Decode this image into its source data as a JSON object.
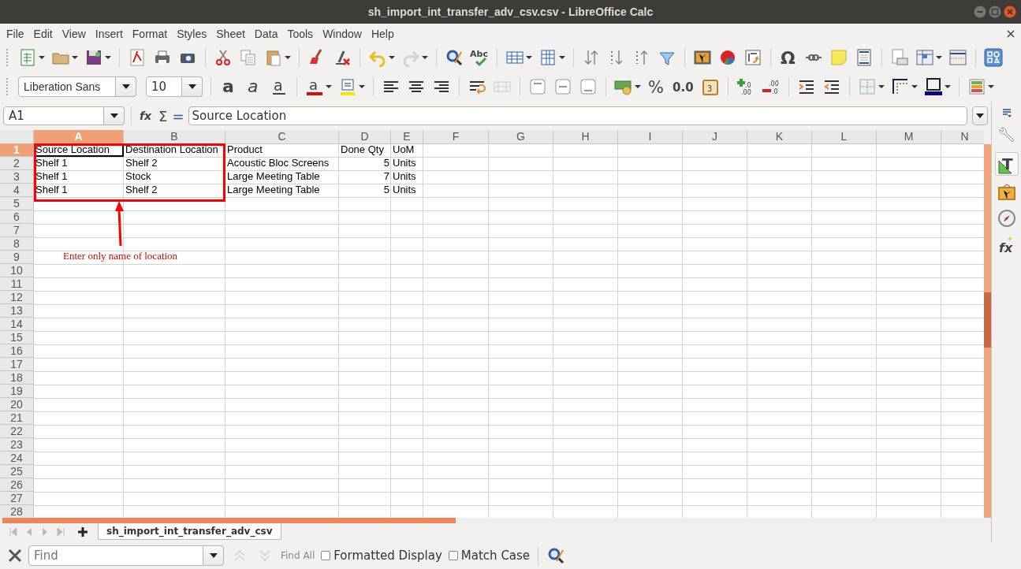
{
  "window": {
    "title": "sh_import_int_transfer_adv_csv.csv - LibreOffice Calc"
  },
  "menu": [
    "File",
    "Edit",
    "View",
    "Insert",
    "Format",
    "Styles",
    "Sheet",
    "Data",
    "Tools",
    "Window",
    "Help"
  ],
  "standard_toolbar": {
    "spelling_label": "Abc",
    "special_character_label": "Ω",
    "redo_disabled": true
  },
  "formatting_toolbar": {
    "font_name": "Liberation Sans",
    "font_size": "10",
    "bold_label": "a",
    "italic_label": "a",
    "underline_label": "a",
    "font_color_label": "a",
    "merge_disabled": true,
    "percent_label": "%",
    "decimal_label": "0.0",
    "date_label": "3",
    "add_decimal_label": [
      ".0",
      ".00"
    ],
    "delete_decimal_label": [
      ".00",
      ".0"
    ]
  },
  "formula_bar": {
    "name_box": "A1",
    "function_wizard_label": "fx",
    "sum_label": "Σ",
    "formula_label": "=",
    "content": "Source Location"
  },
  "sidebar": {
    "properties_label": "T",
    "functions_label": "fx"
  },
  "columns": [
    {
      "label": "A",
      "selected": true
    },
    {
      "label": "B",
      "selected": false
    },
    {
      "label": "C",
      "selected": false
    },
    {
      "label": "D",
      "selected": false
    },
    {
      "label": "E",
      "selected": false
    },
    {
      "label": "F",
      "selected": false
    },
    {
      "label": "G",
      "selected": false
    },
    {
      "label": "H",
      "selected": false
    },
    {
      "label": "I",
      "selected": false
    },
    {
      "label": "J",
      "selected": false
    },
    {
      "label": "K",
      "selected": false
    },
    {
      "label": "L",
      "selected": false
    },
    {
      "label": "M",
      "selected": false
    },
    {
      "label": "N",
      "selected": false
    }
  ],
  "rows": [
    {
      "label": "1",
      "selected": true,
      "cells": [
        {
          "text": "Source Location",
          "kind": "text"
        },
        {
          "text": "Destination Location",
          "kind": "text"
        },
        {
          "text": "Product",
          "kind": "text"
        },
        {
          "text": "Done Qty",
          "kind": "text"
        },
        {
          "text": "UoM",
          "kind": "text"
        }
      ]
    },
    {
      "label": "2",
      "selected": false,
      "cells": [
        {
          "text": "Shelf 1",
          "kind": "text"
        },
        {
          "text": "Shelf 2",
          "kind": "text"
        },
        {
          "text": "Acoustic Bloc Screens",
          "kind": "text"
        },
        {
          "text": "5",
          "kind": "number"
        },
        {
          "text": "Units",
          "kind": "text"
        }
      ]
    },
    {
      "label": "3",
      "selected": false,
      "cells": [
        {
          "text": "Shelf 1",
          "kind": "text"
        },
        {
          "text": "Stock",
          "kind": "text"
        },
        {
          "text": "Large Meeting Table",
          "kind": "text"
        },
        {
          "text": "7",
          "kind": "number"
        },
        {
          "text": "Units",
          "kind": "text"
        }
      ]
    },
    {
      "label": "4",
      "selected": false,
      "cells": [
        {
          "text": "Shelf 1",
          "kind": "text"
        },
        {
          "text": "Shelf 2",
          "kind": "text"
        },
        {
          "text": "Large Meeting Table",
          "kind": "text"
        },
        {
          "text": "5",
          "kind": "number"
        },
        {
          "text": "Units",
          "kind": "text"
        }
      ]
    },
    {
      "label": "5",
      "selected": false
    },
    {
      "label": "6",
      "selected": false
    },
    {
      "label": "7",
      "selected": false
    },
    {
      "label": "8",
      "selected": false
    },
    {
      "label": "9",
      "selected": false
    },
    {
      "label": "10",
      "selected": false
    },
    {
      "label": "11",
      "selected": false
    },
    {
      "label": "12",
      "selected": false
    },
    {
      "label": "13",
      "selected": false
    },
    {
      "label": "14",
      "selected": false
    },
    {
      "label": "15",
      "selected": false
    },
    {
      "label": "16",
      "selected": false
    },
    {
      "label": "17",
      "selected": false
    },
    {
      "label": "18",
      "selected": false
    },
    {
      "label": "19",
      "selected": false
    },
    {
      "label": "20",
      "selected": false
    },
    {
      "label": "21",
      "selected": false
    },
    {
      "label": "22",
      "selected": false
    },
    {
      "label": "23",
      "selected": false
    },
    {
      "label": "24",
      "selected": false
    },
    {
      "label": "25",
      "selected": false
    },
    {
      "label": "26",
      "selected": false
    },
    {
      "label": "27",
      "selected": false
    },
    {
      "label": "28",
      "selected": false
    }
  ],
  "annotation": {
    "note": "Enter only name of location"
  },
  "sheet_tabs": [
    {
      "label": "sh_import_int_transfer_adv_csv",
      "selected": true
    }
  ],
  "find_bar": {
    "placeholder": "Find",
    "navigation_disabled": true,
    "find_all": "Find All",
    "options": [
      {
        "label": "Formatted Display",
        "checked": false
      },
      {
        "label": "Match Case",
        "checked": false
      }
    ]
  }
}
